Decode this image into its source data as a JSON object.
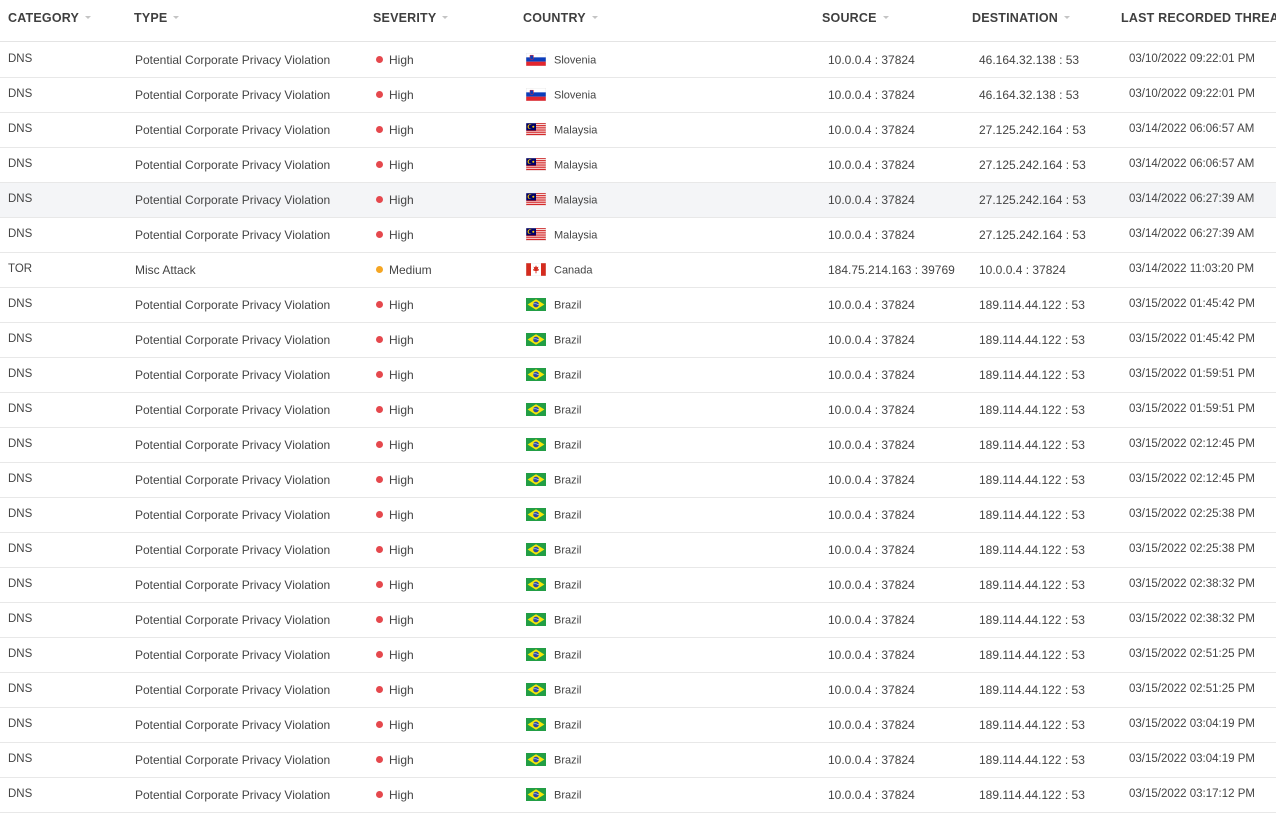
{
  "columns": [
    {
      "key": "category",
      "label": "CATEGORY"
    },
    {
      "key": "type",
      "label": "TYPE"
    },
    {
      "key": "severity",
      "label": "SEVERITY"
    },
    {
      "key": "country",
      "label": "COUNTRY"
    },
    {
      "key": "source",
      "label": "SOURCE"
    },
    {
      "key": "destination",
      "label": "DESTINATION"
    },
    {
      "key": "last_recorded",
      "label": "LAST RECORDED THREAT"
    }
  ],
  "severity_colors": {
    "High": "#e5484d",
    "Medium": "#f5a623"
  },
  "flag_icons": {
    "Slovenia": "slovenia-flag-icon",
    "Malaysia": "malaysia-flag-icon",
    "Canada": "canada-flag-icon",
    "Brazil": "brazil-flag-icon"
  },
  "rows": [
    {
      "category": "DNS",
      "type": "Potential Corporate Privacy Violation",
      "severity": "High",
      "country": "Slovenia",
      "source": "10.0.0.4 : 37824",
      "destination": "46.164.32.138 : 53",
      "last_recorded": "03/10/2022 09:22:01 PM"
    },
    {
      "category": "DNS",
      "type": "Potential Corporate Privacy Violation",
      "severity": "High",
      "country": "Slovenia",
      "source": "10.0.0.4 : 37824",
      "destination": "46.164.32.138 : 53",
      "last_recorded": "03/10/2022 09:22:01 PM"
    },
    {
      "category": "DNS",
      "type": "Potential Corporate Privacy Violation",
      "severity": "High",
      "country": "Malaysia",
      "source": "10.0.0.4 : 37824",
      "destination": "27.125.242.164 : 53",
      "last_recorded": "03/14/2022 06:06:57 AM"
    },
    {
      "category": "DNS",
      "type": "Potential Corporate Privacy Violation",
      "severity": "High",
      "country": "Malaysia",
      "source": "10.0.0.4 : 37824",
      "destination": "27.125.242.164 : 53",
      "last_recorded": "03/14/2022 06:06:57 AM"
    },
    {
      "category": "DNS",
      "type": "Potential Corporate Privacy Violation",
      "severity": "High",
      "country": "Malaysia",
      "source": "10.0.0.4 : 37824",
      "destination": "27.125.242.164 : 53",
      "last_recorded": "03/14/2022 06:27:39 AM",
      "hover": true
    },
    {
      "category": "DNS",
      "type": "Potential Corporate Privacy Violation",
      "severity": "High",
      "country": "Malaysia",
      "source": "10.0.0.4 : 37824",
      "destination": "27.125.242.164 : 53",
      "last_recorded": "03/14/2022 06:27:39 AM"
    },
    {
      "category": "TOR",
      "type": "Misc Attack",
      "severity": "Medium",
      "country": "Canada",
      "source": "184.75.214.163 : 39769",
      "destination": "10.0.0.4 : 37824",
      "last_recorded": "03/14/2022 11:03:20 PM"
    },
    {
      "category": "DNS",
      "type": "Potential Corporate Privacy Violation",
      "severity": "High",
      "country": "Brazil",
      "source": "10.0.0.4 : 37824",
      "destination": "189.114.44.122 : 53",
      "last_recorded": "03/15/2022 01:45:42 PM"
    },
    {
      "category": "DNS",
      "type": "Potential Corporate Privacy Violation",
      "severity": "High",
      "country": "Brazil",
      "source": "10.0.0.4 : 37824",
      "destination": "189.114.44.122 : 53",
      "last_recorded": "03/15/2022 01:45:42 PM"
    },
    {
      "category": "DNS",
      "type": "Potential Corporate Privacy Violation",
      "severity": "High",
      "country": "Brazil",
      "source": "10.0.0.4 : 37824",
      "destination": "189.114.44.122 : 53",
      "last_recorded": "03/15/2022 01:59:51 PM"
    },
    {
      "category": "DNS",
      "type": "Potential Corporate Privacy Violation",
      "severity": "High",
      "country": "Brazil",
      "source": "10.0.0.4 : 37824",
      "destination": "189.114.44.122 : 53",
      "last_recorded": "03/15/2022 01:59:51 PM"
    },
    {
      "category": "DNS",
      "type": "Potential Corporate Privacy Violation",
      "severity": "High",
      "country": "Brazil",
      "source": "10.0.0.4 : 37824",
      "destination": "189.114.44.122 : 53",
      "last_recorded": "03/15/2022 02:12:45 PM"
    },
    {
      "category": "DNS",
      "type": "Potential Corporate Privacy Violation",
      "severity": "High",
      "country": "Brazil",
      "source": "10.0.0.4 : 37824",
      "destination": "189.114.44.122 : 53",
      "last_recorded": "03/15/2022 02:12:45 PM"
    },
    {
      "category": "DNS",
      "type": "Potential Corporate Privacy Violation",
      "severity": "High",
      "country": "Brazil",
      "source": "10.0.0.4 : 37824",
      "destination": "189.114.44.122 : 53",
      "last_recorded": "03/15/2022 02:25:38 PM"
    },
    {
      "category": "DNS",
      "type": "Potential Corporate Privacy Violation",
      "severity": "High",
      "country": "Brazil",
      "source": "10.0.0.4 : 37824",
      "destination": "189.114.44.122 : 53",
      "last_recorded": "03/15/2022 02:25:38 PM"
    },
    {
      "category": "DNS",
      "type": "Potential Corporate Privacy Violation",
      "severity": "High",
      "country": "Brazil",
      "source": "10.0.0.4 : 37824",
      "destination": "189.114.44.122 : 53",
      "last_recorded": "03/15/2022 02:38:32 PM"
    },
    {
      "category": "DNS",
      "type": "Potential Corporate Privacy Violation",
      "severity": "High",
      "country": "Brazil",
      "source": "10.0.0.4 : 37824",
      "destination": "189.114.44.122 : 53",
      "last_recorded": "03/15/2022 02:38:32 PM"
    },
    {
      "category": "DNS",
      "type": "Potential Corporate Privacy Violation",
      "severity": "High",
      "country": "Brazil",
      "source": "10.0.0.4 : 37824",
      "destination": "189.114.44.122 : 53",
      "last_recorded": "03/15/2022 02:51:25 PM"
    },
    {
      "category": "DNS",
      "type": "Potential Corporate Privacy Violation",
      "severity": "High",
      "country": "Brazil",
      "source": "10.0.0.4 : 37824",
      "destination": "189.114.44.122 : 53",
      "last_recorded": "03/15/2022 02:51:25 PM"
    },
    {
      "category": "DNS",
      "type": "Potential Corporate Privacy Violation",
      "severity": "High",
      "country": "Brazil",
      "source": "10.0.0.4 : 37824",
      "destination": "189.114.44.122 : 53",
      "last_recorded": "03/15/2022 03:04:19 PM"
    },
    {
      "category": "DNS",
      "type": "Potential Corporate Privacy Violation",
      "severity": "High",
      "country": "Brazil",
      "source": "10.0.0.4 : 37824",
      "destination": "189.114.44.122 : 53",
      "last_recorded": "03/15/2022 03:04:19 PM"
    },
    {
      "category": "DNS",
      "type": "Potential Corporate Privacy Violation",
      "severity": "High",
      "country": "Brazil",
      "source": "10.0.0.4 : 37824",
      "destination": "189.114.44.122 : 53",
      "last_recorded": "03/15/2022 03:17:12 PM"
    }
  ]
}
